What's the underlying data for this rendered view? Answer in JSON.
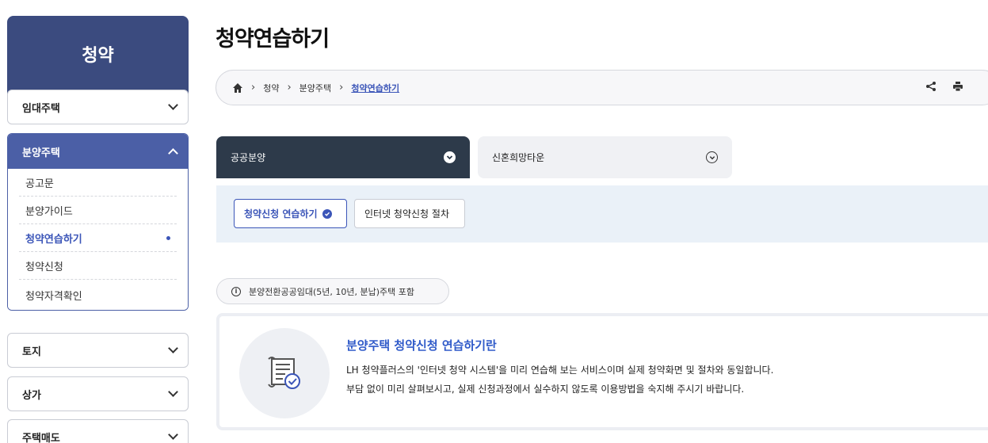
{
  "sidebar": {
    "title": "청약",
    "rental_label": "임대주택",
    "sale_label": "분양주택",
    "sub_items": [
      {
        "label": "공고문"
      },
      {
        "label": "분양가이드"
      },
      {
        "label": "청약연습하기"
      },
      {
        "label": "청약신청"
      },
      {
        "label": "청약자격확인"
      }
    ],
    "land_label": "토지",
    "store_label": "상가",
    "housing_sale_label": "주택매도"
  },
  "page": {
    "title": "청약연습하기"
  },
  "breadcrumb": {
    "items": [
      "청약",
      "분양주택"
    ],
    "current": "청약연습하기"
  },
  "tabs": {
    "public": "공공분양",
    "newlywed": "신혼희망타운"
  },
  "subtabs": {
    "practice": "청약신청 연습하기",
    "procedure": "인터넷 청약신청 절차"
  },
  "notice": {
    "text": "분양전환공공임대(5년, 10년, 분납)주택 포함"
  },
  "info": {
    "title": "분양주택 청약신청 연습하기란",
    "line1": "LH 청약플러스의 '인터넷 청약 시스템'을 미리 연습해 보는 서비스이며 실제 청약화면 및 절차와 동일합니다.",
    "line2": "부담 없이 미리 살펴보시고, 실제 신청과정에서 실수하지 않도록 이용방법을 숙지해 주시기 바랍니다."
  },
  "colors": {
    "sidebar_head": "#3b4b7f",
    "accent": "#4b5fa6",
    "link": "#3b55b8",
    "tab_dark": "#2d3a4a",
    "panel_bg": "#eaf1f8"
  }
}
